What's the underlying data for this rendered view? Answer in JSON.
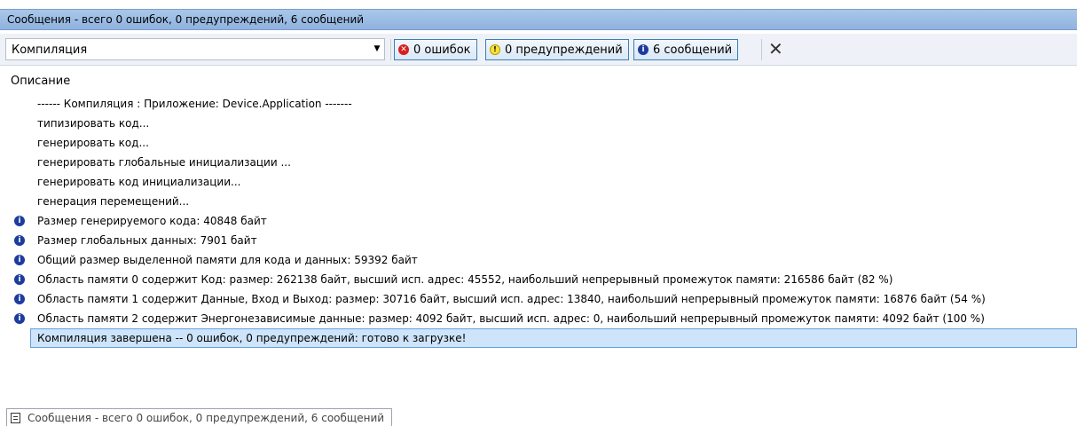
{
  "window": {
    "title": "Сообщения - всего 0 ошибок, 0 предупреждений, 6 сообщений"
  },
  "toolbar": {
    "category_value": "Компиляция",
    "errors_label": "0 ошибок",
    "warnings_label": "0 предупреждений",
    "messages_label": "6 сообщений",
    "error_icon_glyph": "✕",
    "warning_icon_glyph": "!",
    "info_icon_glyph": "i"
  },
  "list": {
    "column_header": "Описание",
    "rows": [
      {
        "text": "------ Компиляция : Приложение: Device.Application -------",
        "icon": "none"
      },
      {
        "text": "типизировать код...",
        "icon": "none"
      },
      {
        "text": "генерировать код...",
        "icon": "none"
      },
      {
        "text": "генерировать глобальные инициализации ...",
        "icon": "none"
      },
      {
        "text": "генерировать код инициализации...",
        "icon": "none"
      },
      {
        "text": "генерация перемещений...",
        "icon": "none"
      },
      {
        "text": "Размер генерируемого кода: 40848 байт",
        "icon": "info-icon"
      },
      {
        "text": "Размер глобальных данных: 7901 байт",
        "icon": "info-icon"
      },
      {
        "text": "Общий размер выделенной памяти для кода и данных: 59392 байт",
        "icon": "info-icon"
      },
      {
        "text": "Область памяти 0 содержит  Код: размер: 262138 байт, высший исп. адрес: 45552, наибольший непрерывный промежуток памяти: 216586 байт (82 %)",
        "icon": "info-icon"
      },
      {
        "text": "Область памяти 1 содержит  Данные, Вход и Выход: размер: 30716 байт, высший исп. адрес: 13840, наибольший непрерывный промежуток памяти: 16876 байт (54 %)",
        "icon": "info-icon"
      },
      {
        "text": "Область памяти 2 содержит  Энергонезависимые данные: размер: 4092 байт, высший исп. адрес: 0, наибольший непрерывный промежуток памяти: 4092 байт (100 %)",
        "icon": "info-icon"
      },
      {
        "text": "Компиляция завершена -- 0 ошибок, 0 предупреждений: готово к загрузке!",
        "icon": "none",
        "selected": true
      }
    ]
  },
  "status_tab": {
    "label": "Сообщения - всего 0 ошибок, 0 предупреждений, 6 сообщений"
  },
  "colors": {
    "selection": "#cde4fa",
    "title_bar": "#a9c7ea",
    "info_icon": "#1d3c9e",
    "error_icon": "#d51f1f",
    "warning_icon": "#f7e33b"
  }
}
